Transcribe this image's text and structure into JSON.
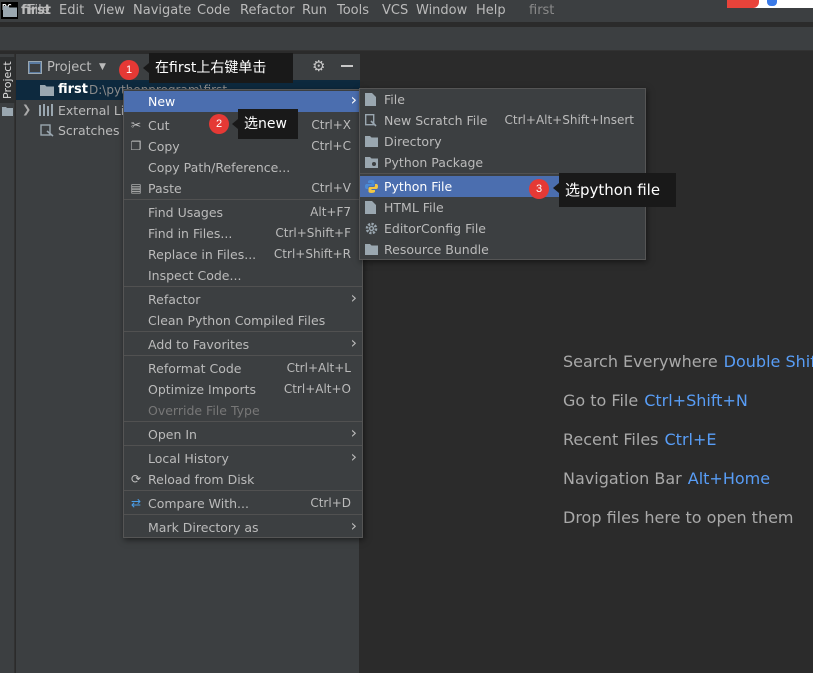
{
  "menubar": {
    "logo": "PC",
    "items": [
      "File",
      "Edit",
      "View",
      "Navigate",
      "Code",
      "Refactor",
      "Run",
      "Tools",
      "VCS",
      "Window",
      "Help"
    ],
    "window_title": "first"
  },
  "breadcrumb": {
    "label": "first"
  },
  "left_stripe": {
    "project_tab": "Project"
  },
  "project_panel": {
    "title": "Project",
    "tree": {
      "first_label": "first",
      "first_path": "D:\\pythonprogram\\first",
      "external_libraries": "External Libraries",
      "scratches": "Scratches and Consoles"
    }
  },
  "callouts": [
    {
      "number": "1",
      "text": "在first上右键单击"
    },
    {
      "number": "2",
      "text": "选new"
    },
    {
      "number": "3",
      "text": "选python file"
    }
  ],
  "context_menu": {
    "items": [
      {
        "label": "New",
        "shortcut": "",
        "submenu": true,
        "selected": true,
        "icon": ""
      },
      {
        "label": "Cut",
        "shortcut": "Ctrl+X",
        "icon": "scissors-icon",
        "glyph": "✂"
      },
      {
        "label": "Copy",
        "shortcut": "Ctrl+C",
        "icon": "copy-icon",
        "glyph": "❐"
      },
      {
        "label": "Copy Path/Reference...",
        "shortcut": ""
      },
      {
        "label": "Paste",
        "shortcut": "Ctrl+V",
        "icon": "paste-icon",
        "glyph": "▤"
      },
      {
        "label": "Find Usages",
        "shortcut": "Alt+F7"
      },
      {
        "label": "Find in Files...",
        "shortcut": "Ctrl+Shift+F"
      },
      {
        "label": "Replace in Files...",
        "shortcut": "Ctrl+Shift+R"
      },
      {
        "label": "Inspect Code...",
        "shortcut": ""
      },
      {
        "label": "Refactor",
        "shortcut": "",
        "submenu": true
      },
      {
        "label": "Clean Python Compiled Files",
        "shortcut": ""
      },
      {
        "label": "Add to Favorites",
        "shortcut": "",
        "submenu": true
      },
      {
        "label": "Reformat Code",
        "shortcut": "Ctrl+Alt+L"
      },
      {
        "label": "Optimize Imports",
        "shortcut": "Ctrl+Alt+O"
      },
      {
        "label": "Override File Type",
        "shortcut": "",
        "disabled": true
      },
      {
        "label": "Open In",
        "shortcut": "",
        "submenu": true
      },
      {
        "label": "Local History",
        "shortcut": "",
        "submenu": true
      },
      {
        "label": "Reload from Disk",
        "shortcut": "",
        "icon": "reload-icon",
        "glyph": "⟳"
      },
      {
        "label": "Compare With...",
        "shortcut": "Ctrl+D",
        "icon": "compare-icon",
        "glyph": "⇄"
      },
      {
        "label": "Mark Directory as",
        "shortcut": "",
        "submenu": true
      }
    ]
  },
  "sub_menu": {
    "items": [
      {
        "label": "File",
        "shortcut": "",
        "icon": "file-icon"
      },
      {
        "label": "New Scratch File",
        "shortcut": "Ctrl+Alt+Shift+Insert",
        "icon": "scratch-file-icon"
      },
      {
        "label": "Directory",
        "shortcut": "",
        "icon": "folder-icon"
      },
      {
        "label": "Python Package",
        "shortcut": "",
        "icon": "package-icon"
      },
      {
        "label": "Python File",
        "shortcut": "",
        "icon": "python-icon",
        "selected": true
      },
      {
        "label": "HTML File",
        "shortcut": "",
        "icon": "html-icon"
      },
      {
        "label": "EditorConfig File",
        "shortcut": "",
        "icon": "gear-icon"
      },
      {
        "label": "Resource Bundle",
        "shortcut": "",
        "icon": "bundle-icon"
      }
    ]
  },
  "editor_hints": [
    {
      "label": "Search Everywhere",
      "key": "Double Shift"
    },
    {
      "label": "Go to File",
      "key": "Ctrl+Shift+N"
    },
    {
      "label": "Recent Files",
      "key": "Ctrl+E"
    },
    {
      "label": "Navigation Bar",
      "key": "Alt+Home"
    },
    {
      "label": "Drop files here to open them",
      "key": ""
    }
  ],
  "colors": {
    "background": "#2b2b2b",
    "panel": "#3c3f41",
    "selection": "#4b6eaf",
    "tree_selection": "#0d293e",
    "hint_key": "#589df6",
    "badge": "#e53935"
  }
}
